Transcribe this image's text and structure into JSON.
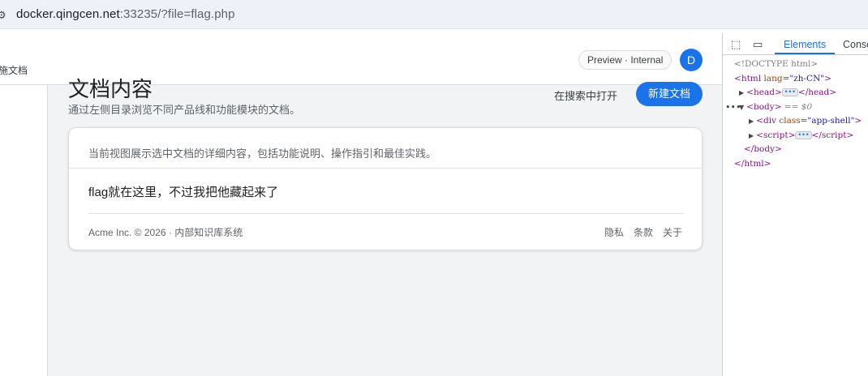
{
  "address_bar": {
    "url_host": "docker.qingcen.net",
    "url_rest": ":33235/?file=flag.php"
  },
  "header": {
    "crumb": "施文档",
    "badge": "Preview · Internal",
    "avatar_letter": "D"
  },
  "main": {
    "title": "文档内容",
    "subtitle": "通过左侧目录浏览不同产品线和功能模块的文档。",
    "open_in_search": "在搜索中打开",
    "new_doc_button": "新建文档"
  },
  "card": {
    "description": "当前视图展示选中文档的详细内容，包括功能说明、操作指引和最佳实践。",
    "body_text": "flag就在这里，不过我把他藏起来了",
    "footer_text": "Acme Inc. © 2026 · 内部知识库系统",
    "footer_links": [
      "隐私",
      "条款",
      "关于"
    ]
  },
  "devtools": {
    "tabs": [
      "Elements",
      "Console"
    ],
    "active_tab": "Elements",
    "tree": {
      "doctype": "<!DOCTYPE html>",
      "html_open_tag": "html",
      "html_attr": "lang",
      "html_attr_val": "\"zh-CN\"",
      "head": "head",
      "body": "body",
      "body_ref": "== $0",
      "div_tag": "div",
      "div_attr": "class",
      "div_attr_val": "\"app-shell\"",
      "script": "script",
      "body_close": "</body>",
      "html_close": "</html>"
    }
  },
  "colors": {
    "accent": "#1a73e8",
    "page_bg": "#f1f3f4"
  }
}
